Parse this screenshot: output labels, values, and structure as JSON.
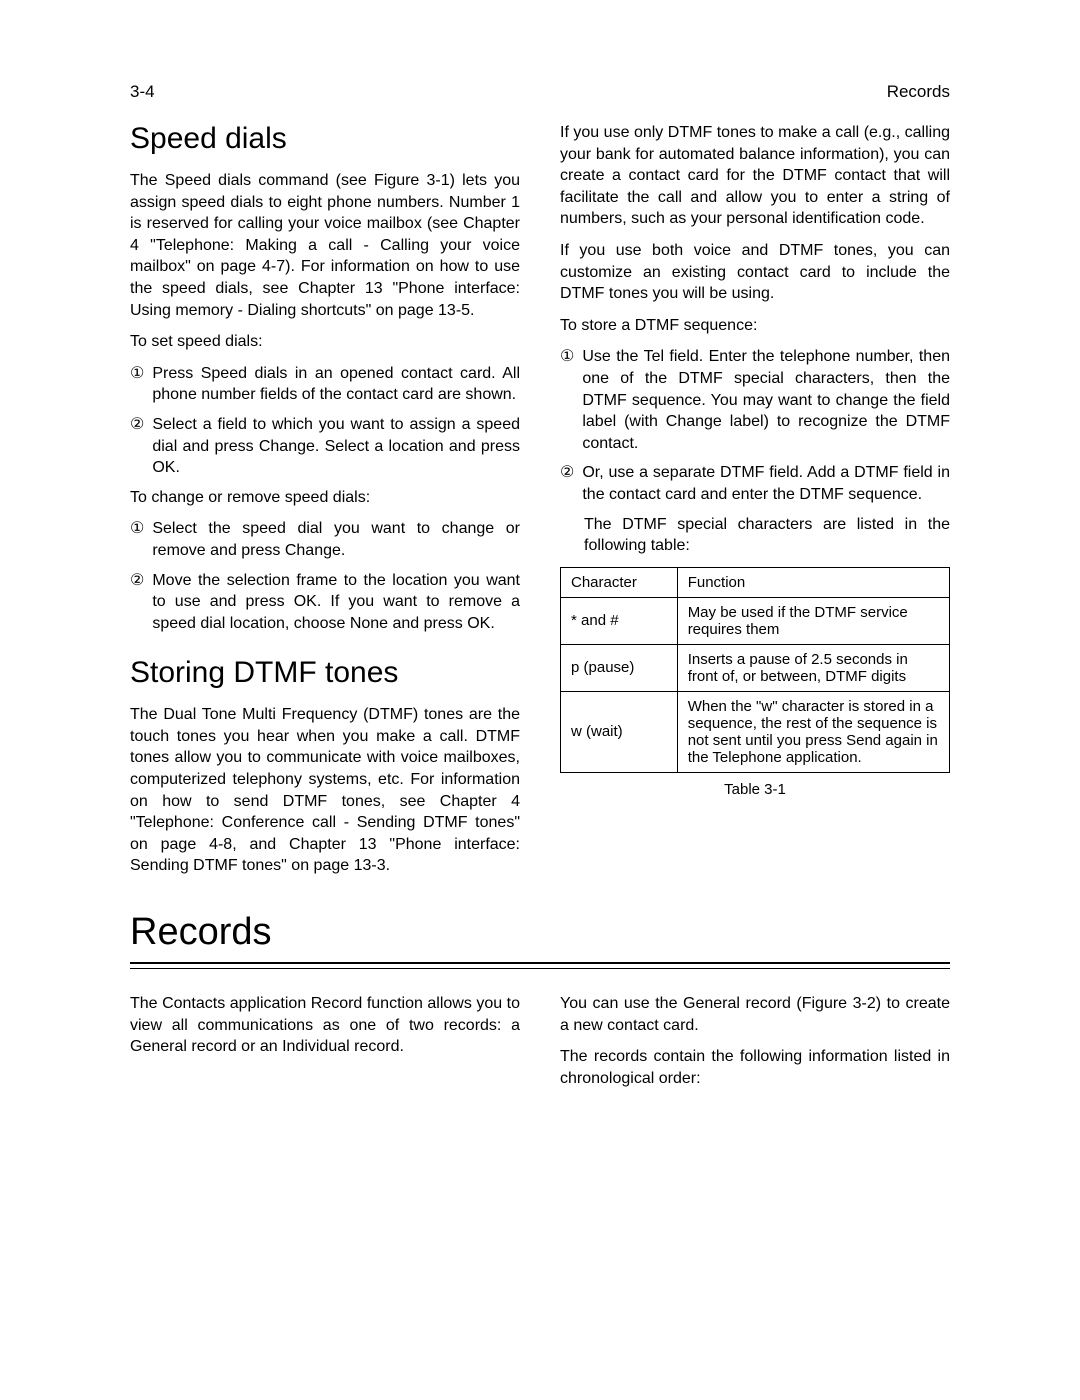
{
  "header": {
    "page_number": "3-4",
    "section": "Records"
  },
  "left": {
    "h2_speed": "Speed dials",
    "p_speed_intro": "The Speed dials command (see Figure 3-1) lets you assign speed dials to eight phone numbers. Number 1 is reserved for calling your voice mailbox (see Chapter 4 \"Telephone: Making a call - Calling your voice mailbox\" on page 4-7). For information on how to use the speed dials, see Chapter 13 \"Phone interface: Using memory - Dialing shortcuts\" on page 13-5.",
    "p_set": "To set speed dials:",
    "l_set_1": "Press Speed dials in an opened contact card. All phone number fields of the contact card are shown.",
    "l_set_2": "Select a field to which you want to assign a speed dial and press Change. Select a location and press OK.",
    "p_change": "To change or remove speed dials:",
    "l_change_1": "Select the speed dial you want to change or remove and press Change.",
    "l_change_2": "Move the selection frame to the location you want to use and press OK. If you want to remove a speed dial location, choose None and press OK.",
    "h2_dtmf": "Storing DTMF tones",
    "p_dtmf_intro": "The Dual Tone Multi Frequency (DTMF) tones are the touch tones you hear when you make a call. DTMF tones allow you to communicate with voice mailboxes, computerized telephony systems, etc. For information on how to send DTMF tones, see Chapter 4 \"Telephone: Conference call - Sending DTMF tones\" on page 4-8, and Chapter 13 \"Phone interface: Sending DTMF tones\" on page 13-3."
  },
  "right": {
    "p_usecase1": "If you use only DTMF tones to make a call (e.g., calling your bank for automated balance information), you can create a contact card for the DTMF contact that will facilitate the call and allow you to enter a string of numbers, such as your personal identification code.",
    "p_usecase2": "If you use both voice and DTMF tones, you can customize an existing contact card to include the DTMF tones you will be using.",
    "p_store": "To store a DTMF sequence:",
    "l_store_1": "Use the Tel field. Enter the telephone number, then one of the DTMF special characters, then the DTMF sequence. You may want to change the field label (with Change label) to recognize the DTMF contact.",
    "l_store_2": "Or, use a separate DTMF field. Add a DTMF field in the contact card and enter the DTMF sequence.",
    "p_special": "The DTMF special characters are listed in the following table:",
    "table": {
      "head_char": "Character",
      "head_func": "Function",
      "rows": [
        {
          "char": "* and #",
          "func": "May be used if the DTMF service requires them"
        },
        {
          "char": "p (pause)",
          "func": "Inserts a pause of 2.5 seconds in front of, or between, DTMF digits"
        },
        {
          "char": "w (wait)",
          "func": "When the \"w\" character is stored in a sequence, the rest of the sequence is not sent until you press Send again in the Telephone application."
        }
      ],
      "caption": "Table 3-1"
    }
  },
  "records": {
    "h1": "Records",
    "left": "The Contacts application Record function allows you to view all communications as one of two records: a General record or an Individual record.",
    "right1": "You can use the General record (Figure 3-2) to create a new contact card.",
    "right2": "The records contain the following information listed in chronological order:"
  },
  "markers": {
    "circled1": "①",
    "circled2": "②"
  }
}
